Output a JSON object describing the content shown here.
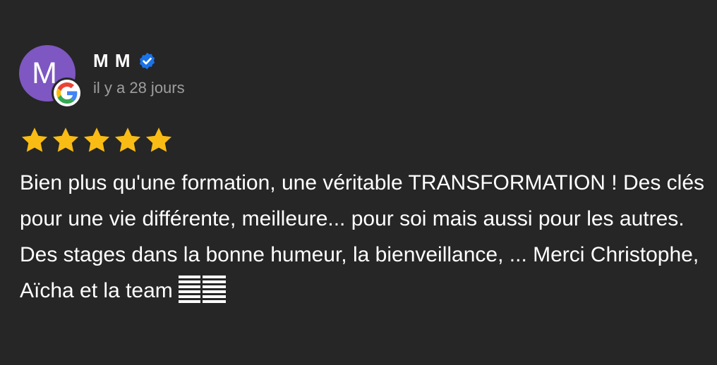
{
  "review": {
    "avatar_letter": "M",
    "avatar_color": "#7e57c2",
    "source_icon": "google-icon",
    "reviewer_name": "M M",
    "verified_icon": "verified-badge-icon",
    "date": "il y a 28 jours",
    "rating": 5,
    "rating_max": 5,
    "star_color": "#f9bc15",
    "text": "Bien plus qu'une formation, une véritable TRANSFORMATION ! Des clés pour une vie différente, meilleure... pour soi mais aussi pour les autres. Des stages dans la bonne humeur, la bienveillance, ... Merci Christophe, Aïcha et la team",
    "trailing_icon": "flag-icon"
  },
  "colors": {
    "background": "#262626",
    "text": "#ffffff",
    "date": "#9e9e9e",
    "verified": "#1a73e8"
  }
}
